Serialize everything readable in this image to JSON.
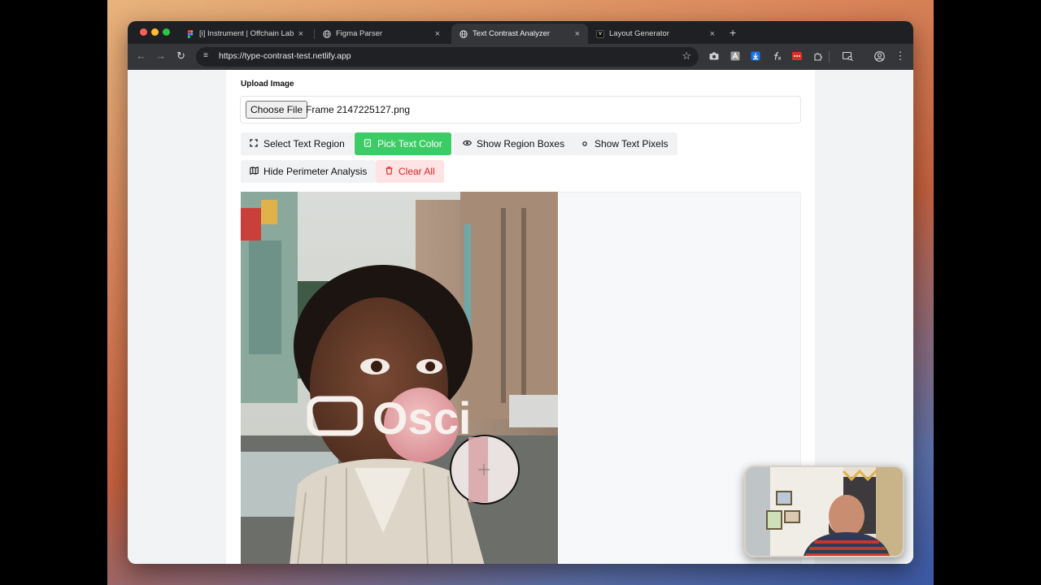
{
  "browser": {
    "tabs": [
      {
        "title": "[i] Instrument | Offchain Labs",
        "icon": "figma-icon",
        "active": false
      },
      {
        "title": "Figma Parser",
        "icon": "globe-icon",
        "active": false
      },
      {
        "title": "Text Contrast Analyzer",
        "icon": "globe-icon",
        "active": true
      },
      {
        "title": "Layout Generator",
        "icon": "v0-icon",
        "active": false
      }
    ],
    "close_glyph": "×",
    "new_tab": "+",
    "url": "https://type-contrast-test.netlify.app",
    "v0_glyph": "v"
  },
  "page": {
    "upload_label": "Upload Image",
    "choose_file": "Choose File",
    "file_name": "Frame 2147225127.png",
    "buttons": {
      "select_region": "Select Text Region",
      "pick_color": "Pick Text Color",
      "show_boxes": "Show Region Boxes",
      "show_pixels": "Show Text Pixels",
      "hide_perimeter": "Hide Perimeter Analysis",
      "clear_all": "Clear All"
    },
    "image_overlay_text": "Osci"
  },
  "colors": {
    "accent_green": "#3ccc65",
    "danger_red": "#dc2626",
    "danger_bg": "#fde3e3"
  }
}
